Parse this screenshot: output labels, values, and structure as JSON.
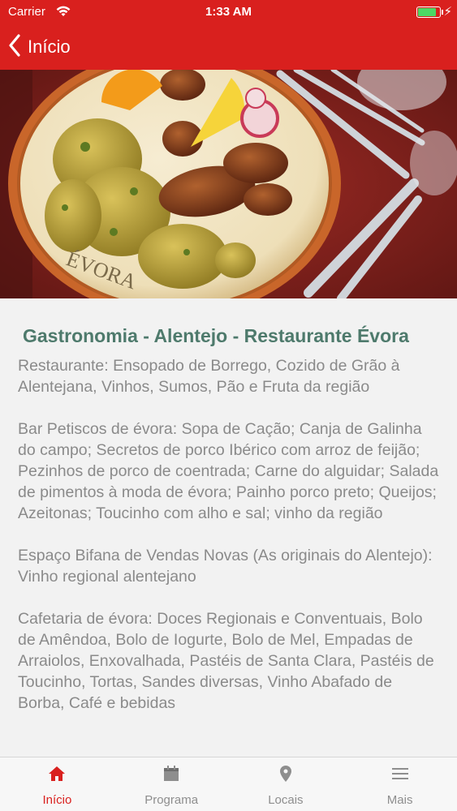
{
  "status_bar": {
    "carrier": "Carrier",
    "time": "1:33 AM",
    "battery_level": 0.85
  },
  "nav": {
    "back_label": "Início"
  },
  "hero": {
    "plate_text": "ÉVORA"
  },
  "article": {
    "title": "Gastronomia - Alentejo - Restaurante Évora",
    "paragraphs": [
      "Restaurante: Ensopado de Borrego, Cozido de Grão à Alentejana, Vinhos, Sumos, Pão e Fruta da região",
      "Bar Petiscos de évora: Sopa de Cação; Canja de Galinha do campo; Secretos de porco Ibérico com arroz de feijão; Pezinhos de porco de coentrada; Carne do alguidar; Salada de pimentos à moda de évora; Painho porco preto; Queijos; Azeitonas; Toucinho com alho e sal; vinho da região",
      "Espaço Bifana de Vendas Novas (As originais do Alentejo): Vinho regional alentejano",
      "Cafetaria de évora: Doces Regionais e Conventuais, Bolo de Amêndoa, Bolo de Iogurte, Bolo de Mel, Empadas de Arraiolos, Enxovalhada, Pastéis de Santa Clara, Pastéis de Toucinho, Tortas, Sandes diversas, Vinho Abafado de Borba, Café e bebidas"
    ]
  },
  "tabs": [
    {
      "label": "Início",
      "icon": "home-icon",
      "active": true
    },
    {
      "label": "Programa",
      "icon": "calendar-icon",
      "active": false
    },
    {
      "label": "Locais",
      "icon": "location-pin-icon",
      "active": false
    },
    {
      "label": "Mais",
      "icon": "menu-icon",
      "active": false
    }
  ],
  "colors": {
    "brand_red": "#d9201e",
    "title_green": "#4e7a6c",
    "body_gray": "#8a8a8a"
  }
}
